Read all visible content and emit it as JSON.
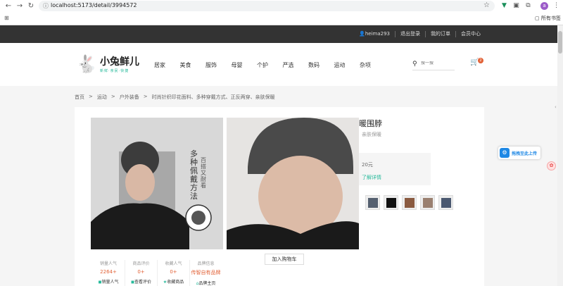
{
  "browser": {
    "url": "localhost:5173/detail/3994572",
    "bookmarks_label": "所有书签",
    "avatar_letter": "a"
  },
  "topbar": {
    "links": [
      "heima293",
      "退出登录",
      "我的订单",
      "会员中心"
    ]
  },
  "header": {
    "logo_title": "小兔鲜儿",
    "logo_sub": "新鲜·亲民·快捷",
    "nav": [
      "居家",
      "美食",
      "服饰",
      "母婴",
      "个护",
      "严选",
      "数码",
      "运动",
      "杂项"
    ],
    "search_placeholder": "搜一搜",
    "cart_count": "2"
  },
  "breadcrumb": [
    "首页",
    ">",
    "运动",
    ">",
    "户外装备",
    ">",
    "时尚针织印花面料、多种穿戴方式、正反两穿、亲肤保暖"
  ],
  "product": {
    "title_partial": "暖围脖",
    "desc_partial": "亲肤保暖",
    "image_text_main": "多种佩戴方法",
    "image_text_side": "百搭又耐看",
    "price_partial": "20元",
    "detail_link": "了解详情",
    "add_cart": "加入购物车",
    "stats": [
      {
        "label": "销量人气",
        "value": "2264+",
        "link": "销量人气",
        "icon": "◼"
      },
      {
        "label": "商品评价",
        "value": "0+",
        "link": "查看评价",
        "icon": "◼"
      },
      {
        "label": "收藏人气",
        "value": "0+",
        "link": "收藏商品",
        "icon": "★"
      },
      {
        "label": "品牌信息",
        "value": "传智自有品牌",
        "link": "品牌主页",
        "icon": "⌂"
      }
    ],
    "thumb_colors": [
      "#556070",
      "#111111",
      "#8a5a40",
      "#9a8070",
      "#4a5870"
    ]
  },
  "floating": {
    "upload_text": "拖拽至此上传"
  },
  "colors": {
    "accent": "#27ba9b",
    "price": "#e26237",
    "topbar": "#333333"
  }
}
